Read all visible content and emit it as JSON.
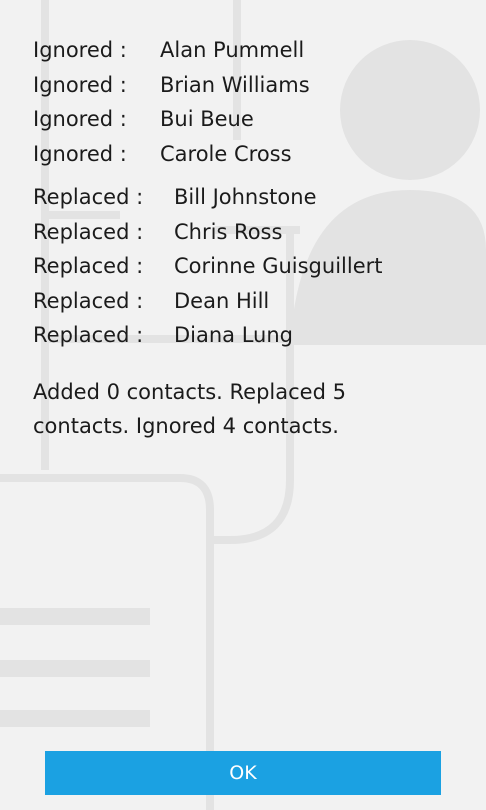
{
  "ignored": [
    {
      "status": "Ignored :",
      "name": "Alan Pummell"
    },
    {
      "status": "Ignored :",
      "name": "Brian Williams"
    },
    {
      "status": "Ignored :",
      "name": "Bui Beue"
    },
    {
      "status": "Ignored :",
      "name": "Carole Cross"
    }
  ],
  "replaced": [
    {
      "status": "Replaced :",
      "name": "Bill Johnstone"
    },
    {
      "status": "Replaced :",
      "name": "Chris Ross"
    },
    {
      "status": "Replaced :",
      "name": "Corinne Guisguillert"
    },
    {
      "status": "Replaced :",
      "name": "Dean Hill"
    },
    {
      "status": "Replaced :",
      "name": "Diana Lung"
    }
  ],
  "summary": "Added 0 contacts. Replaced 5 contacts. Ignored 4 contacts.",
  "ok_label": "OK",
  "colors": {
    "background": "#f2f2f2",
    "accent": "#1ba1e2",
    "watermark": "#e3e3e3"
  },
  "background_icons": [
    "contact-card-icon",
    "person-silhouette-icon"
  ]
}
